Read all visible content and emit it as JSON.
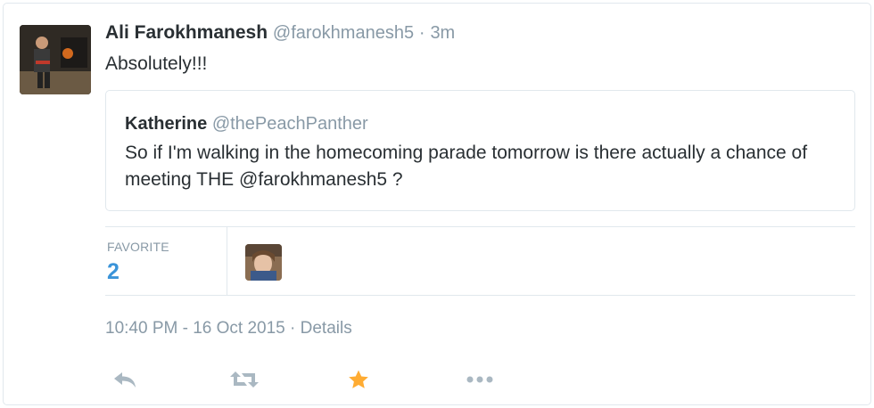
{
  "tweet": {
    "fullname": "Ali Farokhmanesh",
    "username": "@farokhmanesh5",
    "separator": "·",
    "time": "3m",
    "text": "Absolutely!!!"
  },
  "quote": {
    "fullname": "Katherine",
    "username": "@thePeachPanther",
    "text": "So if I'm walking in the homecoming parade tomorrow is there actually a chance of meeting THE @farokhmanesh5 ?"
  },
  "stats": {
    "label": "FAVORITE",
    "count": "2"
  },
  "meta": {
    "timestamp": "10:40 PM - 16 Oct 2015",
    "separator": "·",
    "details_link": "Details"
  },
  "actions": {
    "icons": [
      "reply-icon",
      "retweet-icon",
      "favorite-star-icon",
      "more-icon"
    ],
    "favorite_active_color": "#ffac33",
    "inactive_color": "#aab8c2"
  },
  "colors": {
    "link": "#3b94d9",
    "muted": "#8899a6",
    "text": "#292f33",
    "border": "#e1e8ed"
  }
}
